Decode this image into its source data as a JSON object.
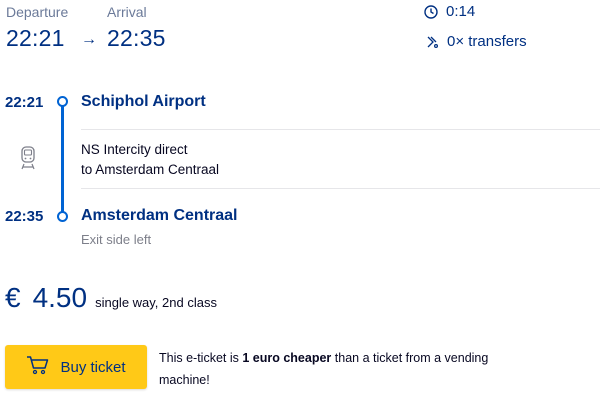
{
  "header": {
    "departure_label": "Departure",
    "arrival_label": "Arrival",
    "departure_time": "22:21",
    "arrow": "→",
    "arrival_time": "22:35",
    "duration": "0:14",
    "transfers": "0× transfers",
    "icons": {
      "duration": "clock-icon",
      "transfers": "transfer-icon"
    }
  },
  "trip": {
    "origin": {
      "time": "22:21",
      "name": "Schiphol Airport"
    },
    "leg": {
      "line1": "NS Intercity direct",
      "line2": "to Amsterdam Centraal",
      "icon": "train-icon"
    },
    "destination": {
      "time": "22:35",
      "name": "Amsterdam Centraal",
      "note": "Exit side left"
    }
  },
  "price": {
    "currency": "€",
    "amount": "4.50",
    "note": "single way, 2nd class"
  },
  "purchase": {
    "button_label": "Buy ticket",
    "button_icon": "cart-icon",
    "promo_prefix": "This e-ticket is ",
    "promo_bold": "1 euro cheaper",
    "promo_suffix": " than a ticket from a vending machine!"
  },
  "colors": {
    "brand_blue": "#003082",
    "rail_blue": "#0063d3",
    "button_yellow": "#ffc917"
  }
}
